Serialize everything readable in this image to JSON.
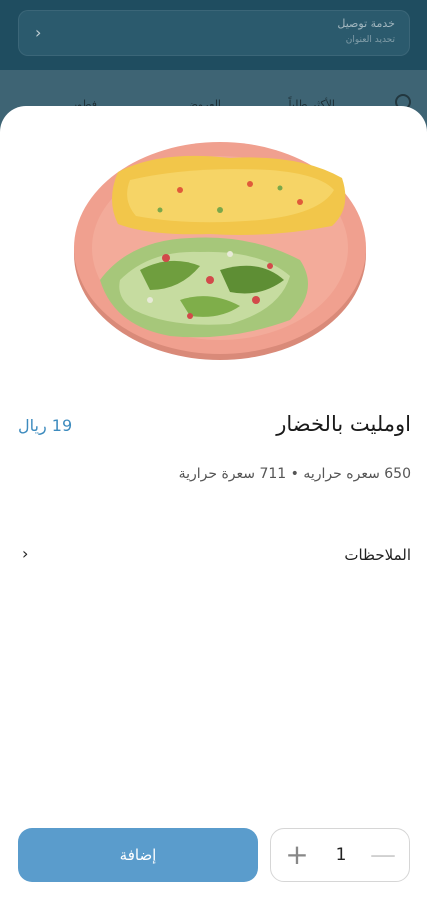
{
  "background": {
    "delivery_title": "خدمة توصيل",
    "delivery_subtitle": "تحديد العنوان",
    "tabs": [
      "الأكثر طلباً",
      "العروض",
      "فطور"
    ]
  },
  "product": {
    "name": "اومليت بالخضار",
    "price": "19 ريال",
    "calories": "650 سعره حراريه • 711 سعرة حرارية"
  },
  "notes": {
    "label": "الملاحظات"
  },
  "actions": {
    "add_label": "إضافة",
    "quantity": "1"
  },
  "colors": {
    "accent": "#5a9ccc",
    "price": "#3d8bbe"
  }
}
